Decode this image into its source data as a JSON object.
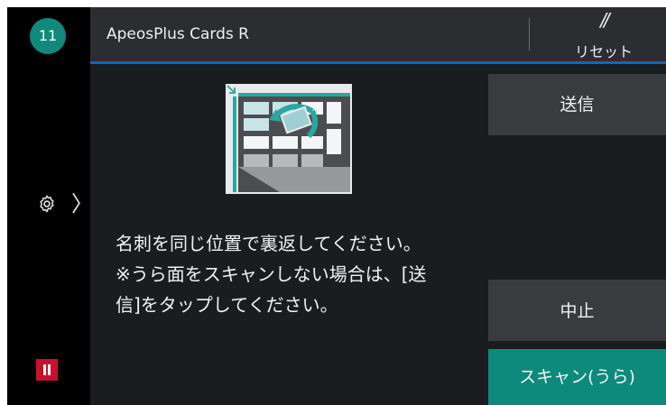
{
  "rail": {
    "job_count": "11",
    "settings_chevron": "〉"
  },
  "header": {
    "title": "ApeosPlus Cards R",
    "reset_icon": "//",
    "reset_label": "リセット"
  },
  "message": {
    "line1": "名刺を同じ位置で裏返してください。",
    "line2": "※うら面をスキャンしない場合は、[送",
    "line3": "信]をタップしてください。"
  },
  "buttons": {
    "send": "送信",
    "stop": "中止",
    "scan_back": "スキャン(うら)"
  },
  "colors": {
    "accent_teal": "#0d8a7c",
    "header_line": "#1565c0",
    "pause_red": "#c8102e"
  }
}
